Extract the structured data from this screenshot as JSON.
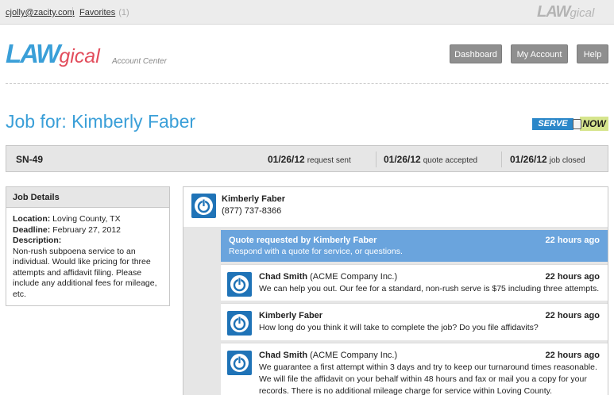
{
  "topbar": {
    "email": "cjolly@zacity.com",
    "favorites_label": "Favorites",
    "favorites_count": "(1)",
    "logo_main": "LAW",
    "logo_suffix": "gical"
  },
  "brand": {
    "logo_main": "LAW",
    "logo_suffix": "gical",
    "subtitle": "Account Center"
  },
  "nav": {
    "dashboard": "Dashboard",
    "my_account": "My Account",
    "help": "Help"
  },
  "page": {
    "title": "Job for: Kimberly Faber"
  },
  "badge": {
    "serve": "SERVE",
    "now": "NOW"
  },
  "job": {
    "id": "SN-49",
    "request_sent_date": "01/26/12",
    "request_sent_label": "request sent",
    "quote_accepted_date": "01/26/12",
    "quote_accepted_label": "quote accepted",
    "job_closed_date": "01/26/12",
    "job_closed_label": "job closed"
  },
  "details": {
    "header": "Job Details",
    "location_label": "Location:",
    "location": "Loving County, TX",
    "deadline_label": "Deadline:",
    "deadline": "February 27, 2012",
    "description_label": "Description:",
    "description": "Non-rush subpoena service to an individual. Would like pricing for three attempts and affidavit filing. Please include any additional fees for mileage, etc."
  },
  "client": {
    "name": "Kimberly Faber",
    "phone": "(877) 737-8366"
  },
  "request": {
    "title": "Quote requested by Kimberly Faber",
    "subtitle": "Respond with a quote for service, or questions.",
    "time": "22 hours ago"
  },
  "messages": [
    {
      "author": "Chad Smith",
      "company": "(ACME Company Inc.)",
      "time": "22 hours ago",
      "text": "We can help you out. Our fee for a standard, non-rush serve is $75 including three attempts."
    },
    {
      "author": "Kimberly Faber",
      "company": "",
      "time": "22 hours ago",
      "text": "How long do you think it will take to complete the job? Do you file affidavits?"
    },
    {
      "author": "Chad Smith",
      "company": "(ACME Company Inc.)",
      "time": "22 hours ago",
      "text": "We guarantee a first attempt within 3 days and try to keep our turnaround times reasonable. We will file the affidavit on your behalf within 48 hours and fax or mail you a copy for your records. There is no additional mileage charge for service within Loving County."
    }
  ],
  "icons": {
    "avatar": "power-icon"
  },
  "colors": {
    "brand_blue": "#3a9fd8",
    "brand_red": "#e24d5c",
    "request_bar": "#6aa4dd",
    "avatar_bg": "#1f73b7"
  }
}
